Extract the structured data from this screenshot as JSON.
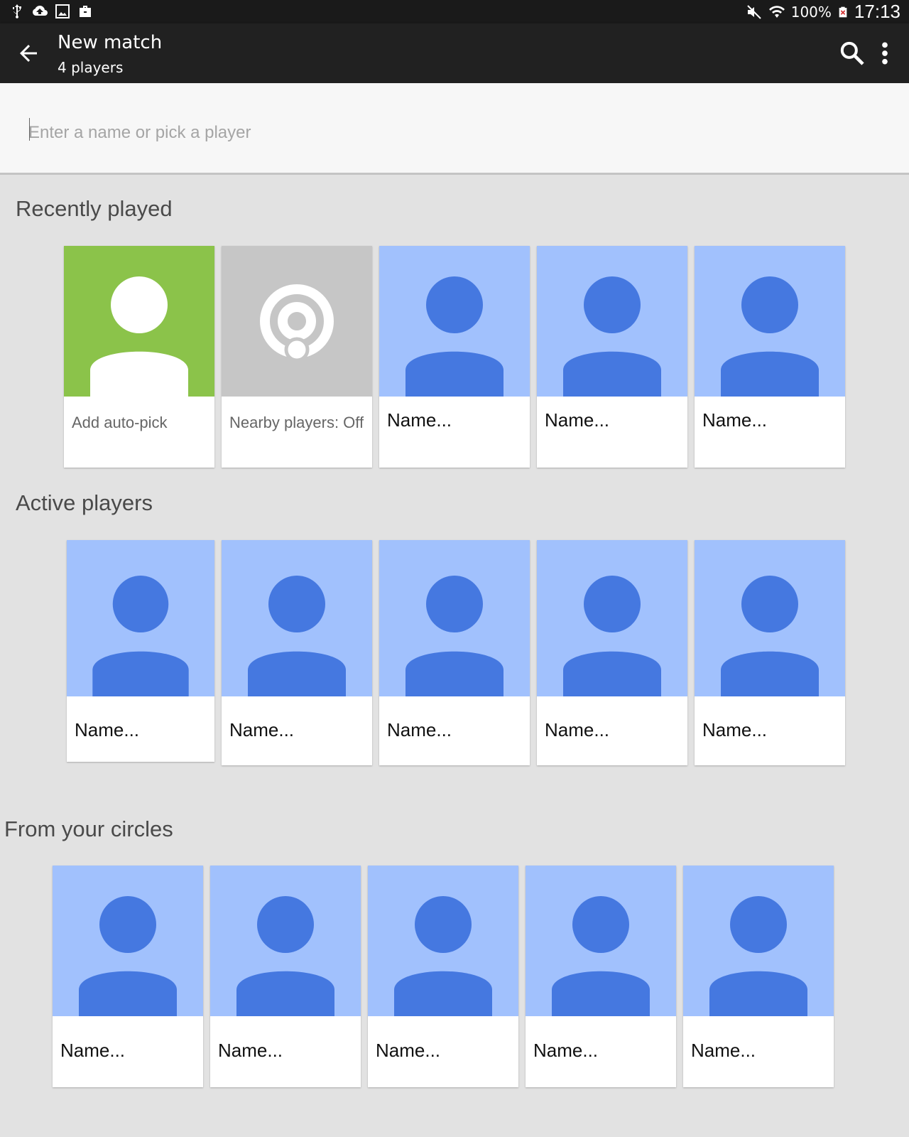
{
  "status_bar": {
    "battery": "100%",
    "time": "17:13",
    "left_icons": [
      "usb-icon",
      "cloud-upload-icon",
      "image-icon",
      "briefcase-icon"
    ],
    "right_icons": [
      "mute-icon",
      "wifi-icon",
      "battery-icon"
    ]
  },
  "app_bar": {
    "title": "New match",
    "subtitle": "4 players",
    "back_icon": "arrow-left-icon",
    "search_icon": "search-icon",
    "overflow_icon": "more-vert-icon"
  },
  "search": {
    "placeholder": "Enter a name or pick a player"
  },
  "colors": {
    "auto_pick_bg": "#8bc34a",
    "nearby_bg": "#c6c6c6",
    "avatar_bg": "#a1c1fd",
    "avatar_fg": "#4578e0"
  },
  "sections": {
    "recent": {
      "title": "Recently played",
      "cards": [
        {
          "label": "Add auto-pick",
          "icon": "auto-pick-icon"
        },
        {
          "label": "Nearby players: Off",
          "icon": "nearby-icon"
        },
        {
          "label": "Name..."
        },
        {
          "label": "Name..."
        },
        {
          "label": "Name..."
        }
      ]
    },
    "active": {
      "title": "Active players",
      "cards": [
        {
          "label": "Name..."
        },
        {
          "label": "Name..."
        },
        {
          "label": "Name..."
        },
        {
          "label": "Name..."
        },
        {
          "label": "Name..."
        }
      ]
    },
    "circles": {
      "title": "From your circles",
      "cards": [
        {
          "label": "Name..."
        },
        {
          "label": "Name..."
        },
        {
          "label": "Name..."
        },
        {
          "label": "Name..."
        },
        {
          "label": "Name..."
        }
      ]
    }
  }
}
